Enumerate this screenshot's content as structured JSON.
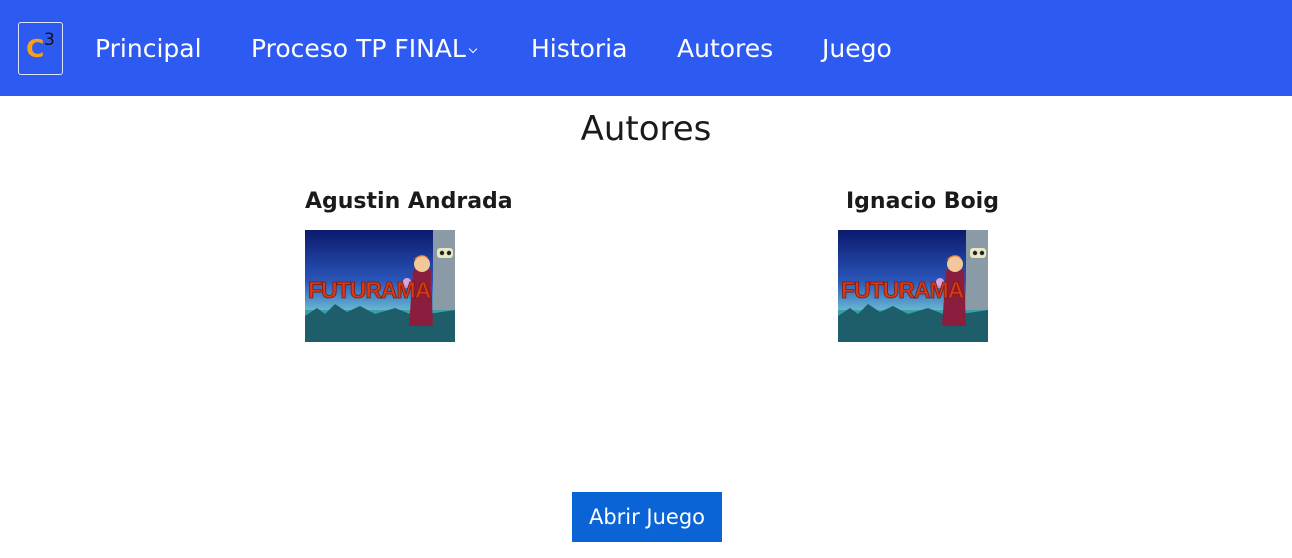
{
  "nav": {
    "brand": {
      "letter": "C",
      "superscript": "3"
    },
    "items": [
      {
        "label": "Principal"
      },
      {
        "label": "Proceso TP FINAL",
        "has_dropdown": true
      },
      {
        "label": "Historia"
      },
      {
        "label": "Autores"
      },
      {
        "label": "Juego"
      }
    ]
  },
  "main": {
    "title": "Autores",
    "authors": [
      {
        "name": "Agustin Andrada",
        "image_logo_text": "FUTURAMA"
      },
      {
        "name": "Ignacio Boig",
        "image_logo_text": "FUTURAMA"
      }
    ],
    "open_game_button": "Abrir Juego"
  },
  "colors": {
    "navbar": "#2d5af0",
    "button": "#0a64d6",
    "brand_letter": "#f5a11b"
  }
}
